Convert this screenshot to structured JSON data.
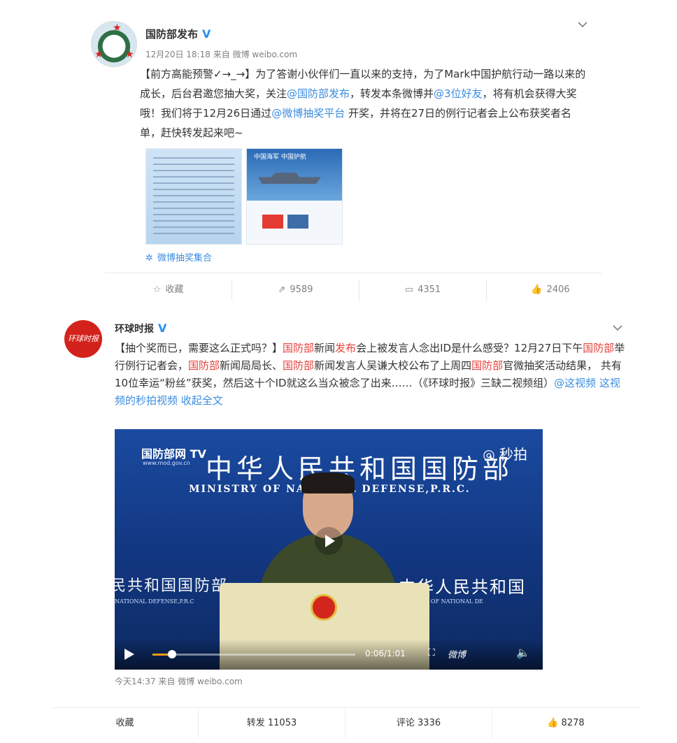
{
  "post1": {
    "author": "国防部发布",
    "verified_mark": "V",
    "meta": "12月20日 18:18 来自 微博 weibo.com",
    "text_parts": [
      {
        "t": "【前方高能预警✓→_→】为了答谢小伙伴们一直以来的支持，为了Mark中国护航行动一路以来的成长，后台君邀您抽大奖，关注",
        "c": ""
      },
      {
        "t": "@国防部发布",
        "c": "link"
      },
      {
        "t": "，转发本条微博并",
        "c": ""
      },
      {
        "t": "@3位好友",
        "c": "link"
      },
      {
        "t": "，将有机会获得大奖哦！我们将于12月26日通过",
        "c": ""
      },
      {
        "t": "@微博抽奖平台",
        "c": "link"
      },
      {
        "t": " 开奖，并将在27日的例行记者会上公布获奖者名单，赶快转发起来吧~",
        "c": ""
      }
    ],
    "image2_caption": "中国海军 中国护航",
    "lottery_link": "微博抽奖集合",
    "actions": [
      {
        "icon": "star-icon",
        "glyph": "☆",
        "label": "收藏"
      },
      {
        "icon": "repost-icon",
        "glyph": "⇗",
        "label": "9589"
      },
      {
        "icon": "comment-icon",
        "glyph": "▭",
        "label": "4351"
      },
      {
        "icon": "like-icon",
        "glyph": "👍",
        "label": "2406"
      }
    ]
  },
  "post2": {
    "author": "环球时报",
    "verified_mark": "V",
    "avatar_text": "环球时报",
    "text_parts": [
      {
        "t": "【抽个奖而已，需要这么正式吗？】",
        "c": ""
      },
      {
        "t": "国防部",
        "c": "red"
      },
      {
        "t": "新闻",
        "c": ""
      },
      {
        "t": "发布",
        "c": "red"
      },
      {
        "t": "会上被发言人念出ID是什么感受？12月27日下午",
        "c": ""
      },
      {
        "t": "国防部",
        "c": "red"
      },
      {
        "t": "举行例行记者会，",
        "c": ""
      },
      {
        "t": "国防部",
        "c": "red"
      },
      {
        "t": "新闻局局长、",
        "c": ""
      },
      {
        "t": "国防部",
        "c": "red"
      },
      {
        "t": "新闻发言人吴谦大校公布了上周四",
        "c": ""
      },
      {
        "t": "国防部",
        "c": "red"
      },
      {
        "t": "官微抽奖活动结果， 共有10位幸运“粉丝”获奖，然后这十个ID就这么当众被念了出来……（《环球时报》三缺二视频组）",
        "c": ""
      },
      {
        "t": "@这视频",
        "c": "link"
      },
      {
        "t": " ",
        "c": ""
      },
      {
        "t": "这视频的秒拍视频",
        "c": "link"
      },
      {
        "t": " ",
        "c": ""
      },
      {
        "t": "收起全文",
        "c": "link"
      }
    ],
    "video": {
      "net_logo": "国防部网 TV",
      "net_sub": "www.mod.gov.cn",
      "cn_title": "中华人民共和国国防部",
      "en_title": "MINISTRY OF NATIONAL DEFENSE,P.R.C.",
      "miaopai": "◎ 秒拍",
      "left_cn": "民共和国国防部",
      "left_en": "NATIONAL DEFENSE,P.R.C",
      "right_cn": "中华人民共和国",
      "right_en": "MINISTRY OF NATIONAL DE",
      "time": "0:06/1:01",
      "watermark": "微博",
      "progress": 0.098
    },
    "meta": "今天14:37 来自 微博 weibo.com",
    "actions": [
      {
        "icon": "favorite-text",
        "label": "收藏"
      },
      {
        "icon": "repost-text",
        "label": "转发 11053"
      },
      {
        "icon": "comment-text",
        "label": "评论 3336"
      },
      {
        "icon": "like-icon",
        "label": "8278"
      }
    ]
  }
}
